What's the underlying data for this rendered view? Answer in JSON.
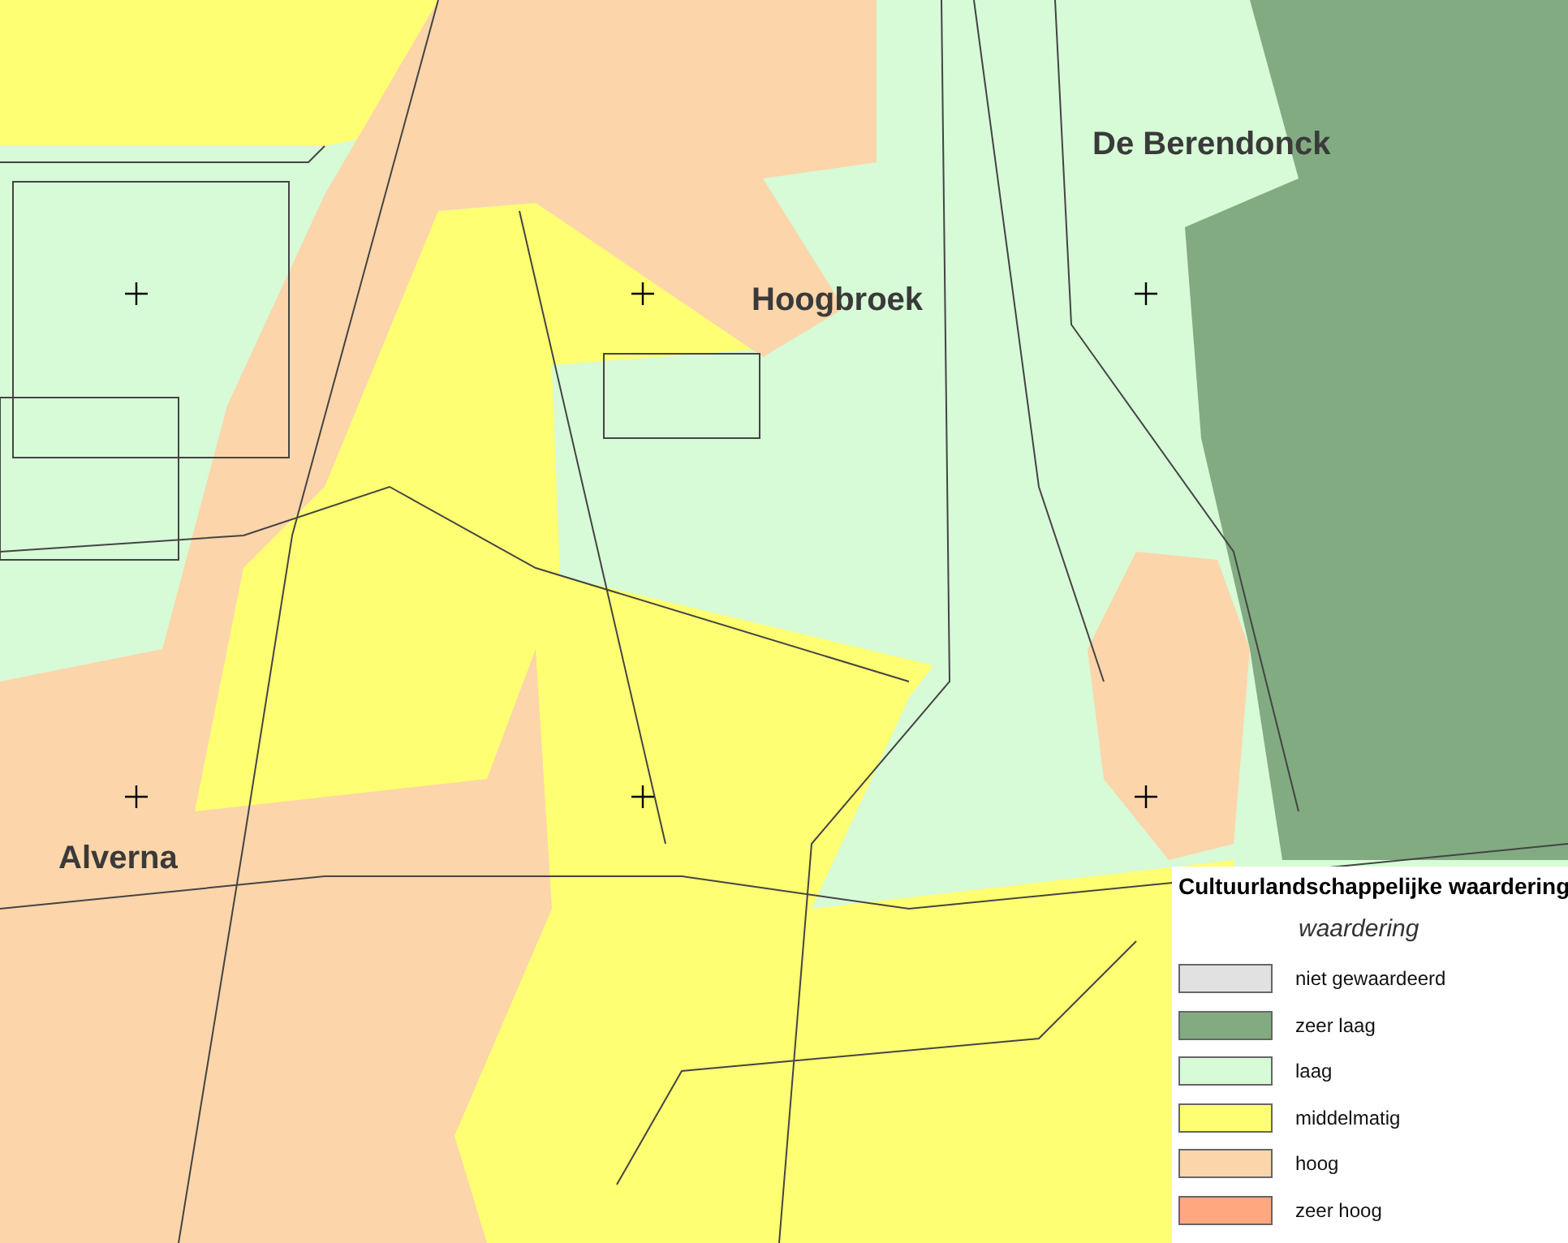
{
  "map": {
    "places": [
      {
        "name": "De Berendonck"
      },
      {
        "name": "Hoogbroek"
      },
      {
        "name": "Alverna"
      }
    ]
  },
  "legend": {
    "title": "Cultuurlandschappelijke waardering",
    "subtitle": "waardering",
    "items": [
      {
        "label": "niet gewaardeerd",
        "color": "#e1e1e1"
      },
      {
        "label": "zeer laag",
        "color": "#82ab82"
      },
      {
        "label": "laag",
        "color": "#d7fad7"
      },
      {
        "label": "middelmatig",
        "color": "#ffff73"
      },
      {
        "label": "hoog",
        "color": "#fcd5aa"
      },
      {
        "label": "zeer hoog",
        "color": "#ffa77f"
      }
    ]
  }
}
